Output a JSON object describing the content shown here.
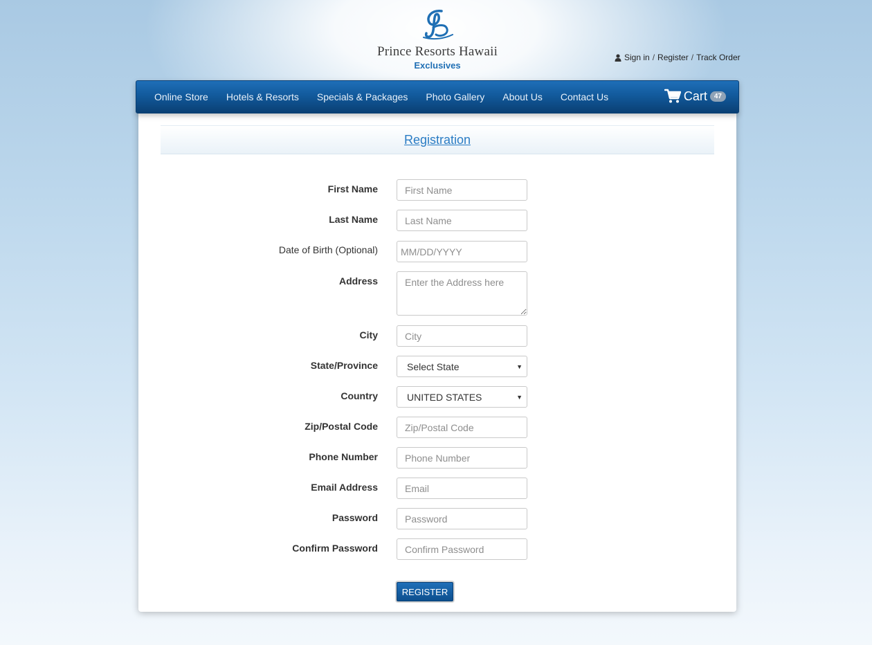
{
  "brand": {
    "name": "Prince Resorts Hawaii",
    "sub": "Exclusives"
  },
  "account": {
    "sign_in": "Sign in",
    "register": "Register",
    "track_order": "Track Order"
  },
  "nav": {
    "items": [
      "Online Store",
      "Hotels & Resorts",
      "Specials & Packages",
      "Photo Gallery",
      "About Us",
      "Contact Us"
    ],
    "cart_label": "Cart",
    "cart_count": "47"
  },
  "page": {
    "title": "Registration"
  },
  "form": {
    "first_name": {
      "label": "First Name",
      "placeholder": "First Name"
    },
    "last_name": {
      "label": "Last Name",
      "placeholder": "Last Name"
    },
    "dob": {
      "label": "Date of Birth (Optional)",
      "placeholder": "MM/DD/YYYY"
    },
    "address": {
      "label": "Address",
      "placeholder": "Enter the Address here"
    },
    "city": {
      "label": "City",
      "placeholder": "City"
    },
    "state": {
      "label": "State/Province",
      "value": "Select State"
    },
    "country": {
      "label": "Country",
      "value": "UNITED STATES"
    },
    "zip": {
      "label": "Zip/Postal Code",
      "placeholder": "Zip/Postal Code"
    },
    "phone": {
      "label": "Phone Number",
      "placeholder": "Phone Number"
    },
    "email": {
      "label": "Email Address",
      "placeholder": "Email"
    },
    "password": {
      "label": "Password",
      "placeholder": "Password"
    },
    "confirm_password": {
      "label": "Confirm Password",
      "placeholder": "Confirm Password"
    },
    "submit_label": "REGISTER"
  },
  "colors": {
    "nav_top": "#1f6fb8",
    "nav_bottom": "#0a3f73",
    "title_link": "#2a7cc4",
    "brand_sub": "#1f6fb4"
  }
}
